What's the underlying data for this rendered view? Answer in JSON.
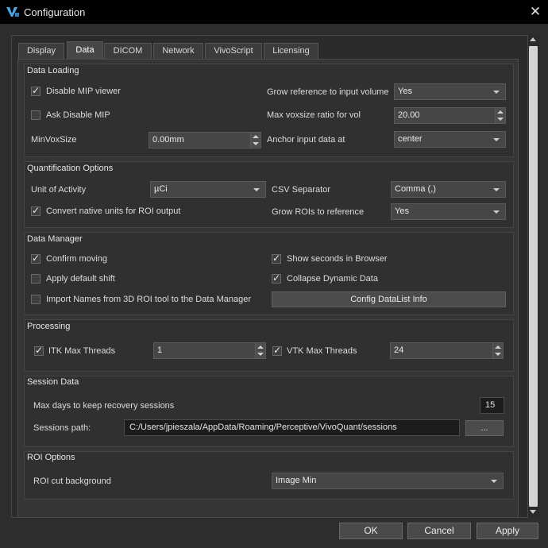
{
  "window": {
    "title": "Configuration",
    "logo_icon": "vq-logo-icon",
    "close_icon": "close-icon"
  },
  "tabs": [
    "Display",
    "Data",
    "DICOM",
    "Network",
    "VivoScript",
    "Licensing"
  ],
  "active_tab": "Data",
  "data_loading": {
    "title": "Data Loading",
    "disable_mip_viewer": {
      "label": "Disable MIP viewer",
      "checked": true
    },
    "ask_disable_mip": {
      "label": "Ask Disable MIP",
      "checked": false
    },
    "min_vox_size": {
      "label": "MinVoxSize",
      "value": "0.00mm"
    },
    "grow_reference": {
      "label": "Grow reference to input volume",
      "value": "Yes"
    },
    "max_voxsize_ratio": {
      "label": "Max voxsize ratio for vol",
      "value": "20.00"
    },
    "anchor_input": {
      "label": "Anchor input data at",
      "value": "center"
    }
  },
  "quantification": {
    "title": "Quantification Options",
    "unit_of_activity": {
      "label": "Unit of Activity",
      "value": "µCi"
    },
    "convert_native": {
      "label": "Convert native units for ROI output",
      "checked": true
    },
    "csv_separator": {
      "label": "CSV Separator",
      "value": "Comma (,)"
    },
    "grow_rois": {
      "label": "Grow ROIs to reference",
      "value": "Yes"
    }
  },
  "data_manager": {
    "title": "Data Manager",
    "confirm_moving": {
      "label": "Confirm moving",
      "checked": true
    },
    "apply_default_shift": {
      "label": "Apply default shift",
      "checked": false
    },
    "import_names": {
      "label": "Import Names from 3D ROI tool to the Data Manager",
      "checked": false
    },
    "show_seconds": {
      "label": "Show seconds in Browser",
      "checked": true
    },
    "collapse_dynamic": {
      "label": "Collapse Dynamic Data",
      "checked": true
    },
    "config_datalist_button": "Config DataList Info"
  },
  "processing": {
    "title": "Processing",
    "itk_max_threads": {
      "label": "ITK Max Threads",
      "checked": true,
      "value": "1"
    },
    "vtk_max_threads": {
      "label": "VTK Max Threads",
      "checked": true,
      "value": "24"
    }
  },
  "session_data": {
    "title": "Session Data",
    "max_days": {
      "label": "Max days to keep recovery sessions",
      "value": "15"
    },
    "sessions_path": {
      "label": "Sessions path:",
      "value": "C:/Users/jpieszala/AppData/Roaming/Perceptive/VivoQuant/sessions"
    },
    "browse_button": "..."
  },
  "roi_options": {
    "title": "ROI Options",
    "cut_background": {
      "label": "ROI cut background",
      "value": "Image Min"
    }
  },
  "buttons": {
    "ok": "OK",
    "cancel": "Cancel",
    "apply": "Apply"
  },
  "colors": {
    "titlebar": "#000000",
    "background": "#2d2d2d",
    "panel": "#353535",
    "text": "#dcdcdc"
  }
}
